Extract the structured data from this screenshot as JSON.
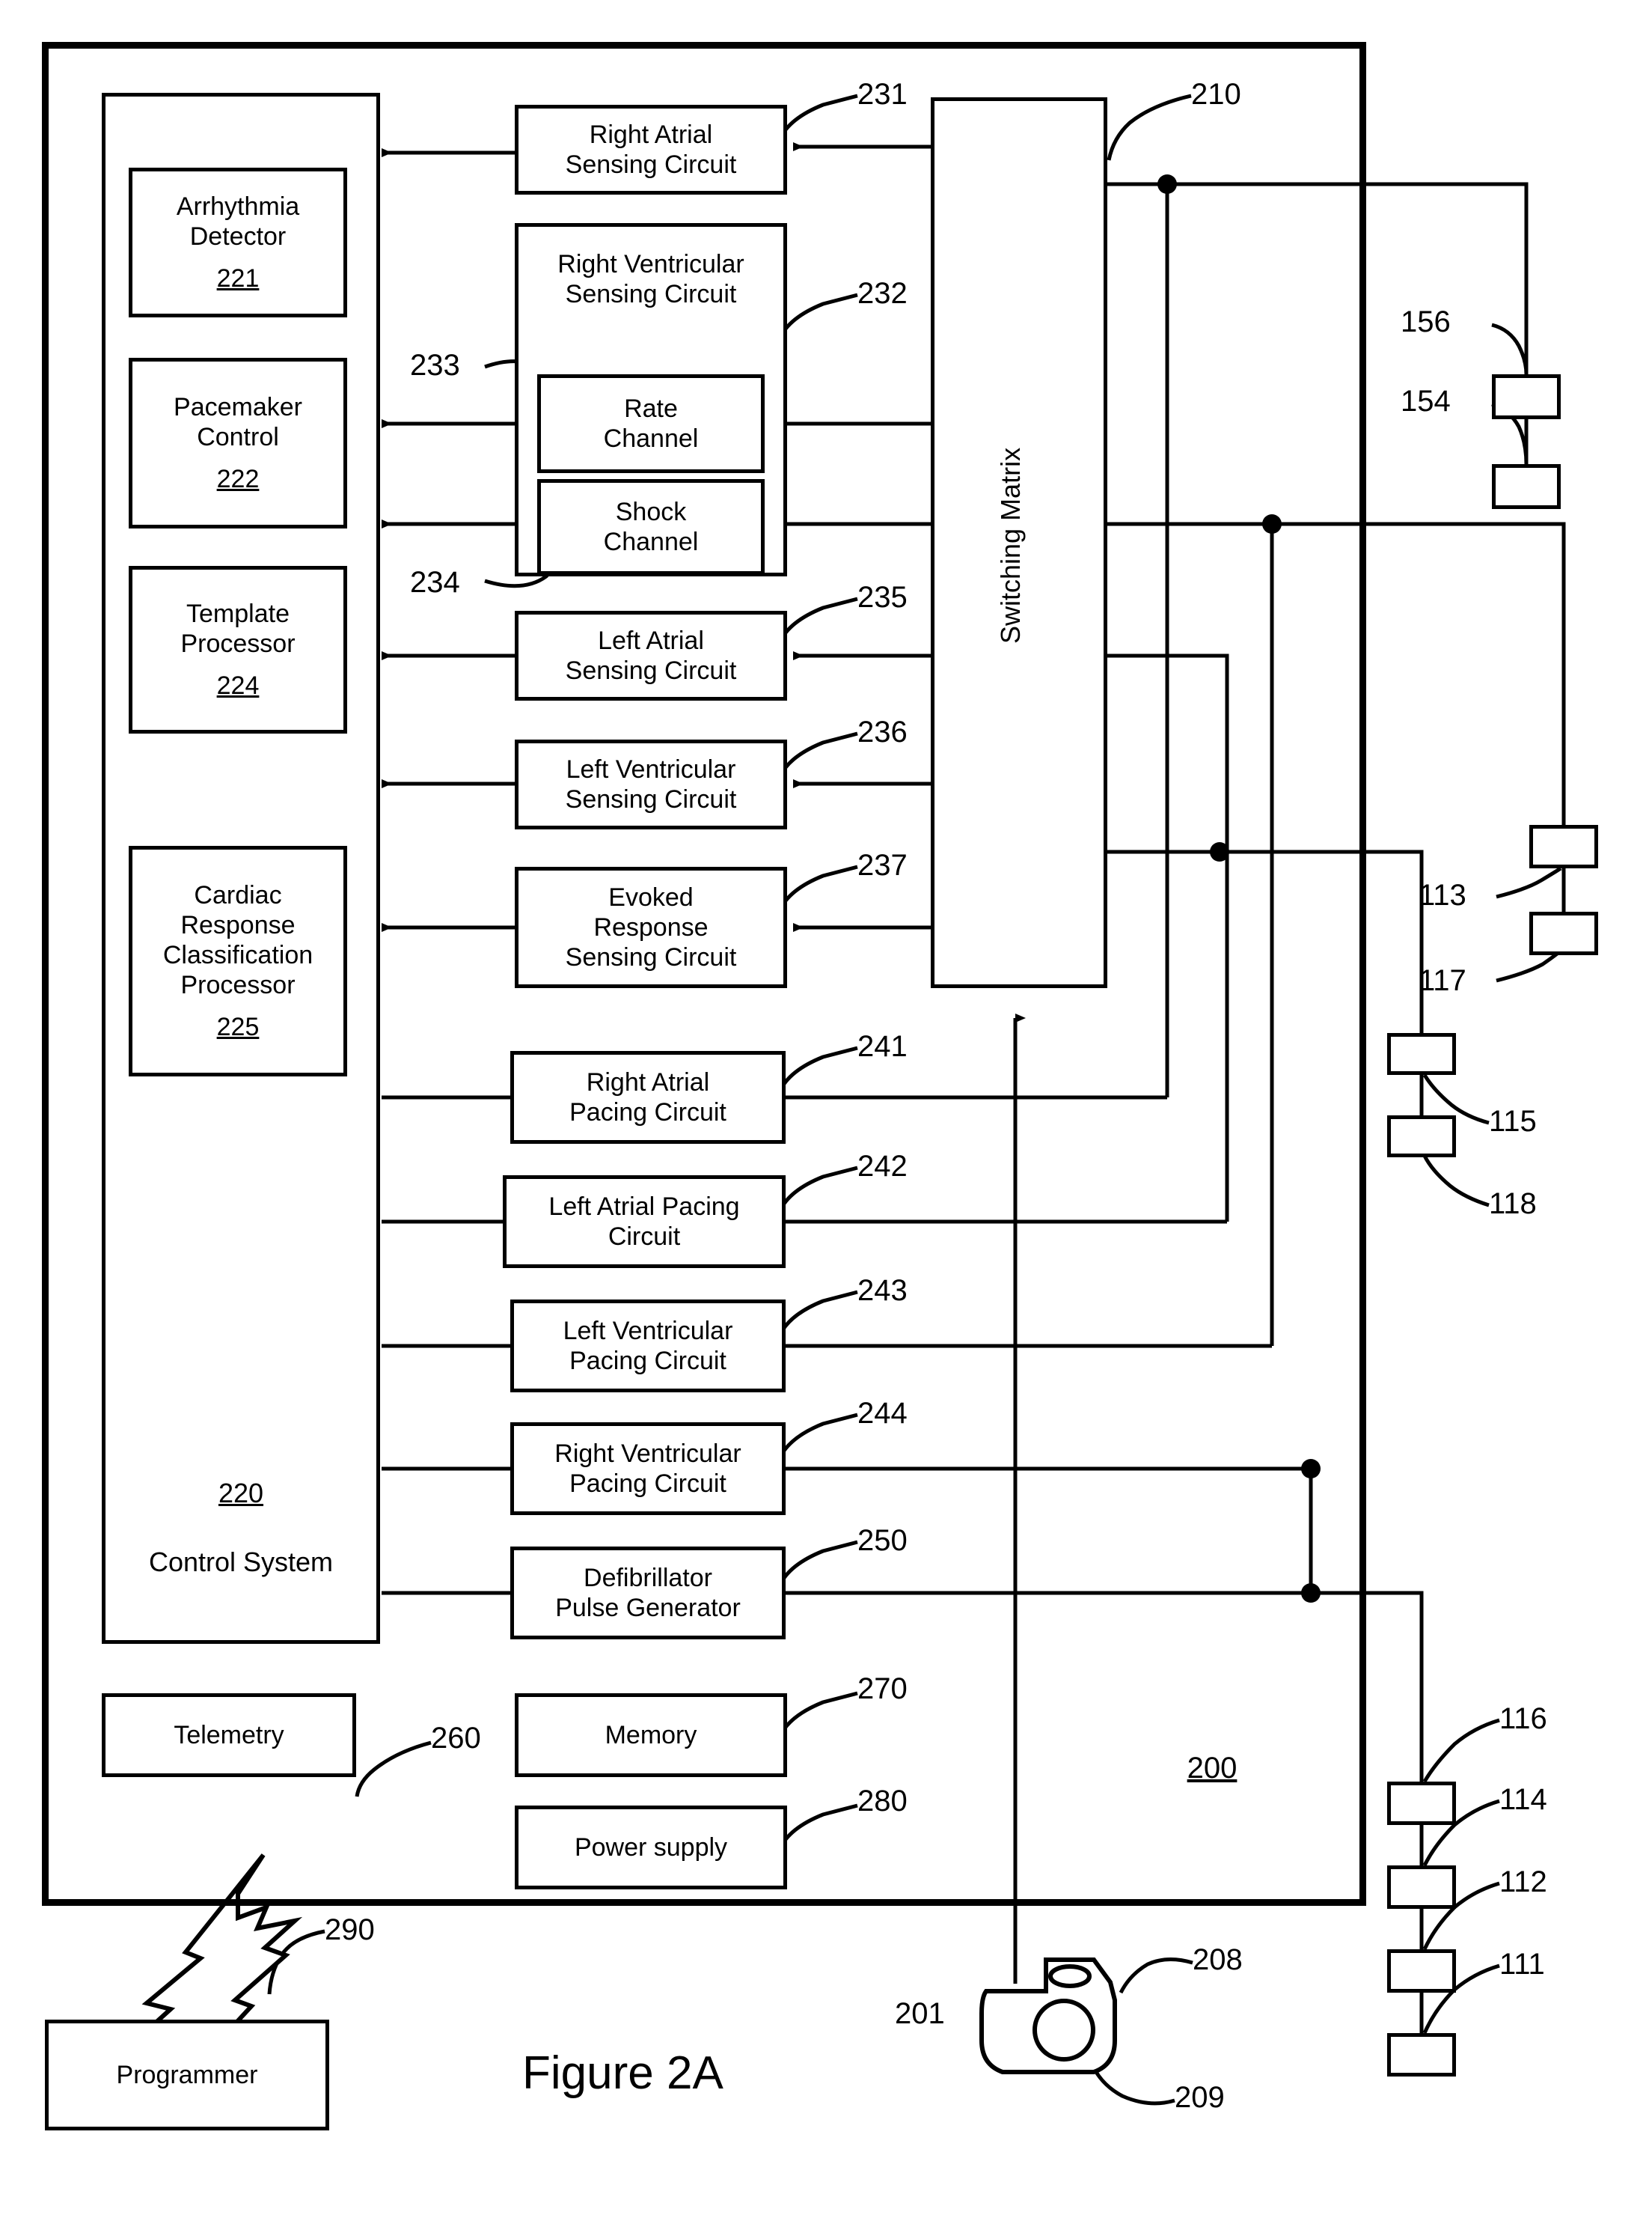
{
  "figure": {
    "caption": "Figure 2A",
    "device_ref": "200"
  },
  "control_system": {
    "label": "Control System",
    "ref": "220",
    "modules": [
      {
        "name": "Arrhythmia Detector",
        "line1": "Arrhythmia",
        "line2": "Detector",
        "ref": "221"
      },
      {
        "name": "Pacemaker Control",
        "line1": "Pacemaker",
        "line2": "Control",
        "ref": "222"
      },
      {
        "name": "Template Processor",
        "line1": "Template",
        "line2": "Processor",
        "ref": "224"
      },
      {
        "name": "Cardiac Response Classification Processor",
        "line1": "Cardiac",
        "line2": "Response",
        "line3": "Classification",
        "line4": "Processor",
        "ref": "225"
      }
    ]
  },
  "sensing_circuits": [
    {
      "line1": "Right Atrial",
      "line2": "Sensing Circuit",
      "ref": "231"
    },
    {
      "line1": "Right Ventricular",
      "line2": "Sensing Circuit",
      "ref": "232"
    },
    {
      "line1": "Left Atrial",
      "line2": "Sensing Circuit",
      "ref": "235"
    },
    {
      "line1": "Left Ventricular",
      "line2": "Sensing Circuit",
      "ref": "236"
    },
    {
      "line1": "Evoked",
      "line2": "Response",
      "line3": "Sensing Circuit",
      "ref": "237"
    }
  ],
  "channels": [
    {
      "line1": "Rate",
      "line2": "Channel",
      "ref": "233"
    },
    {
      "line1": "Shock",
      "line2": "Channel",
      "ref": "234"
    }
  ],
  "pacing_circuits": [
    {
      "line1": "Right Atrial",
      "line2": "Pacing Circuit",
      "ref": "241"
    },
    {
      "line1": "Left Atrial Pacing",
      "line2": "Circuit",
      "ref": "242"
    },
    {
      "line1": "Left Ventricular",
      "line2": "Pacing Circuit",
      "ref": "243"
    },
    {
      "line1": "Right Ventricular",
      "line2": "Pacing Circuit",
      "ref": "244"
    },
    {
      "line1": "Defibrillator",
      "line2": "Pulse Generator",
      "ref": "250"
    }
  ],
  "switching_matrix": {
    "label": "Switching Matrix",
    "ref": "210"
  },
  "support_blocks": [
    {
      "label": "Telemetry",
      "ref": "260"
    },
    {
      "label": "Memory",
      "ref": "270"
    },
    {
      "label": "Power supply",
      "ref": "280"
    }
  ],
  "programmer": {
    "label": "Programmer",
    "ref": "290"
  },
  "sensor": {
    "body_ref": "201",
    "top_ref": "208",
    "circle_ref": "209"
  },
  "electrodes": [
    {
      "ref": "156"
    },
    {
      "ref": "154"
    },
    {
      "ref": "113"
    },
    {
      "ref": "117"
    },
    {
      "ref": "115"
    },
    {
      "ref": "118"
    },
    {
      "ref": "116"
    },
    {
      "ref": "114"
    },
    {
      "ref": "112"
    },
    {
      "ref": "111"
    }
  ],
  "colors": {
    "line": "#000000",
    "background": "#ffffff"
  }
}
